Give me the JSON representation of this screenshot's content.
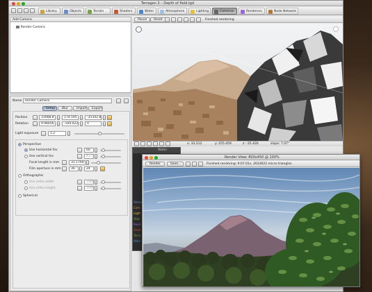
{
  "window_title": "Terragen 3 – Depth of field.tgd",
  "toolbar": {
    "items": [
      {
        "label": "Library",
        "icon": "library-icon"
      },
      {
        "label": "Objects",
        "icon": "objects-icon"
      },
      {
        "label": "Terrain",
        "icon": "terrain-icon"
      },
      {
        "label": "Shaders",
        "icon": "shaders-icon"
      },
      {
        "label": "Water",
        "icon": "water-icon"
      },
      {
        "label": "Atmosphere",
        "icon": "atmosphere-icon"
      },
      {
        "label": "Lighting",
        "icon": "lighting-icon"
      },
      {
        "label": "Cameras",
        "icon": "cameras-icon",
        "active": true
      },
      {
        "label": "Renderers",
        "icon": "renderers-icon"
      },
      {
        "label": "Node Network",
        "icon": "node-network-icon"
      }
    ]
  },
  "left_panel": {
    "add_button": "Add Camera",
    "tree_item": "Render Camera"
  },
  "props": {
    "name_label": "Name",
    "name_value": "Render Camera",
    "tabs": [
      "Setup",
      "Blur",
      "Import",
      "Export"
    ],
    "position_label": "Position",
    "position": [
      "33088.8",
      "174.595",
      "-35342.8"
    ],
    "rotation_label": "Rotation",
    "rotation": [
      "9.96656",
      "-104.022",
      "0"
    ],
    "light_exposure_label": "Light exposure",
    "light_exposure": "1.2",
    "perspective": "Perspective",
    "use_hfov": "Use horizontal fov",
    "hfov": "60",
    "use_vfov": "Use vertical fov",
    "vfov": "43.7",
    "focal_label": "Focal length in mm",
    "focal": "31.1769",
    "aperture_label": "Film aperture in mm",
    "aperture": [
      "36",
      "24"
    ],
    "orthographic": "Orthographic",
    "ortho_width_label": "Use ortho width",
    "ortho_width": "1000",
    "ortho_height_label": "Use ortho height",
    "ortho_height": "1000",
    "spherical": "Spherical"
  },
  "viewport": {
    "pause": "Pause",
    "reset": "Reset",
    "status": "Finished rendering",
    "coords": {
      "x": "x: 33.212",
      "y": "y: 255.459",
      "z": "z: -35.426",
      "slope": "slope: 7.07°"
    }
  },
  "render_window": {
    "title": "Render View: 800x450 @ 100%",
    "render_button": "Render",
    "save_button": "Save...",
    "status": "Finished rendering: 9:07.01s, 2633622 micro-triangles"
  },
  "partial_window": {
    "label": "Water",
    "side_items": [
      "Atmos",
      "Cam",
      "Light",
      "Obje",
      "Rend",
      "Shad",
      "Terra",
      "Wate"
    ]
  },
  "colors": {
    "accent": "#2a63d4",
    "panel": "#e8e8e8",
    "window_chrome": "#d6d6d6"
  }
}
